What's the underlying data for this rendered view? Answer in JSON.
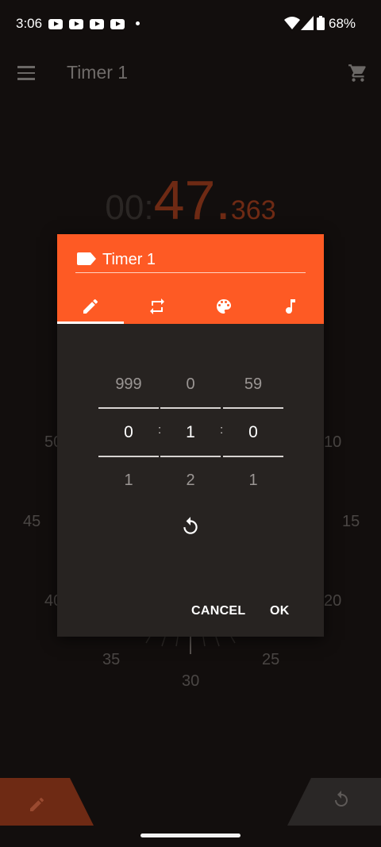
{
  "status_bar": {
    "time": "3:06",
    "battery": "68%"
  },
  "app_bar": {
    "title": "Timer 1"
  },
  "background_timer": {
    "hours": "00:",
    "seconds": "47.",
    "millis": "363"
  },
  "dial_labels": {
    "n50": "50",
    "n10": "10",
    "n45": "45",
    "n15": "15",
    "n40": "40",
    "n20": "20",
    "n35": "35",
    "n25": "25",
    "n30": "30"
  },
  "dialog": {
    "name": "Timer 1",
    "tabs": [
      "edit-icon",
      "repeat-icon",
      "palette-icon",
      "music-note-icon"
    ],
    "picker": {
      "hours": {
        "prev": "999",
        "value": "0",
        "next": "1"
      },
      "minutes": {
        "prev": "0",
        "value": "1",
        "next": "2"
      },
      "seconds": {
        "prev": "59",
        "value": "0",
        "next": "1"
      },
      "separator": ":"
    },
    "cancel_label": "CANCEL",
    "ok_label": "OK"
  },
  "colors": {
    "accent": "#fe5a24",
    "dialog_bg": "#272321",
    "background": "#120e0d"
  }
}
